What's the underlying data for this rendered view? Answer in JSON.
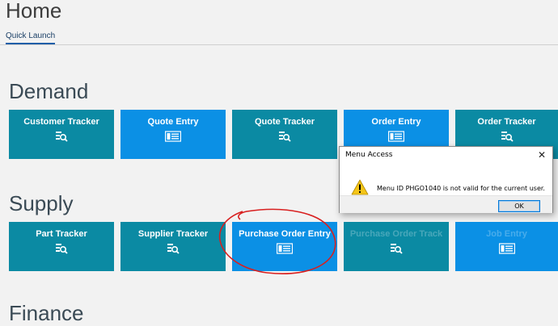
{
  "header": {
    "title": "Home"
  },
  "tabs": [
    {
      "label": "Quick Launch"
    }
  ],
  "sections": {
    "demand": {
      "title": "Demand",
      "tiles": [
        {
          "label": "Customer Tracker",
          "icon": "tracker-search-icon",
          "color": "teal"
        },
        {
          "label": "Quote Entry",
          "icon": "entry-list-icon",
          "color": "blue"
        },
        {
          "label": "Quote Tracker",
          "icon": "tracker-search-icon",
          "color": "teal"
        },
        {
          "label": "Order Entry",
          "icon": "entry-list-icon",
          "color": "blue"
        },
        {
          "label": "Order Tracker",
          "icon": "tracker-search-icon",
          "color": "teal"
        }
      ]
    },
    "supply": {
      "title": "Supply",
      "tiles": [
        {
          "label": "Part Tracker",
          "icon": "tracker-search-icon",
          "color": "teal"
        },
        {
          "label": "Supplier Tracker",
          "icon": "tracker-search-icon",
          "color": "teal"
        },
        {
          "label": "Purchase Order Entry",
          "icon": "entry-list-icon",
          "color": "blue"
        },
        {
          "label": "Purchase Order Track",
          "icon": "tracker-search-icon",
          "color": "teal"
        },
        {
          "label": "Job Entry",
          "icon": "entry-list-icon",
          "color": "blue"
        }
      ]
    },
    "finance": {
      "title": "Finance"
    }
  },
  "dialog": {
    "title": "Menu Access",
    "message": "Menu ID PHGO1040 is not valid for the current user.",
    "ok_label": "OK",
    "icon": "warning-icon"
  },
  "colors": {
    "teal": "#0b8aa3",
    "blue": "#0b90e5",
    "annotation": "#d81f1f"
  }
}
